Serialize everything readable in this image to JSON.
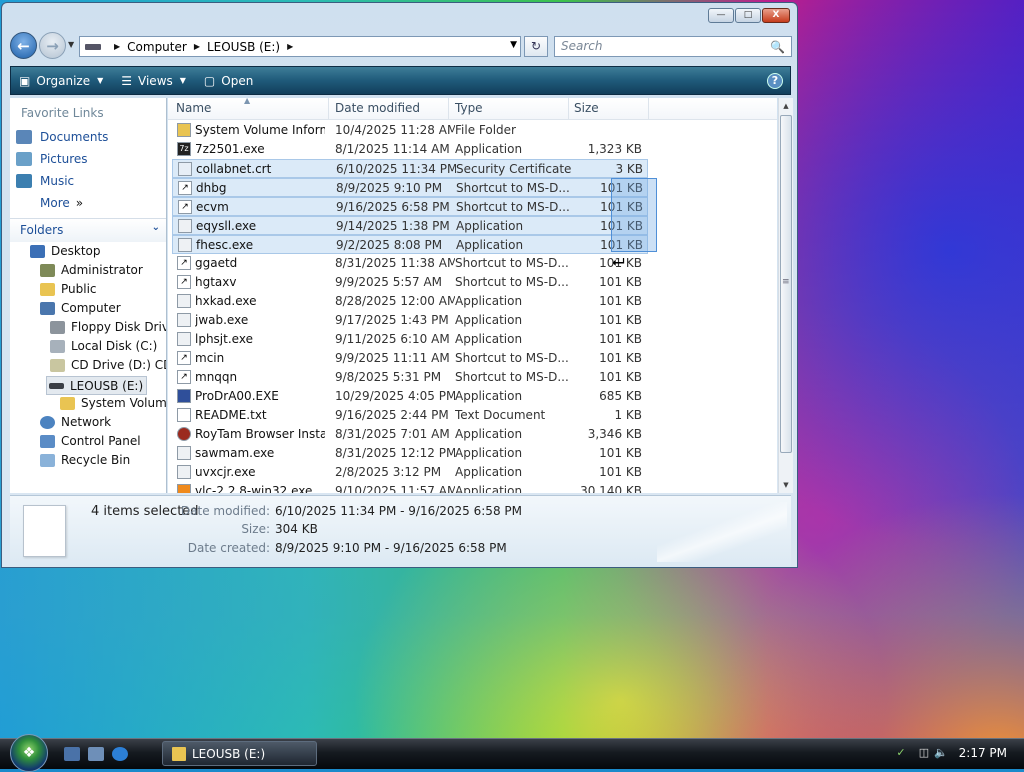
{
  "window": {
    "title_buttons": {
      "minimize": "—",
      "maximize": "□",
      "close": "X"
    },
    "address": {
      "segments": [
        "Computer",
        "LEOUSB (E:)"
      ]
    },
    "search_placeholder": "Search",
    "toolbar": {
      "organize": "Organize",
      "views": "Views",
      "open": "Open",
      "help": "?"
    }
  },
  "left_nav": {
    "favorites_header": "Favorite Links",
    "favorites": [
      {
        "label": "Documents",
        "icon": "documents-icon"
      },
      {
        "label": "Pictures",
        "icon": "pictures-icon"
      },
      {
        "label": "Music",
        "icon": "music-icon"
      },
      {
        "label": "More",
        "icon": "double-chevron-right-icon"
      }
    ],
    "folders_header": "Folders",
    "tree": [
      {
        "label": "Desktop",
        "level": 0
      },
      {
        "label": "Administrator",
        "level": 1
      },
      {
        "label": "Public",
        "level": 1
      },
      {
        "label": "Computer",
        "level": 1
      },
      {
        "label": "Floppy Disk Drive",
        "level": 2
      },
      {
        "label": "Local Disk (C:)",
        "level": 2
      },
      {
        "label": "CD Drive (D:) CDR",
        "level": 2
      },
      {
        "label": "LEOUSB (E:)",
        "level": 2,
        "selected": true
      },
      {
        "label": "System Volume",
        "level": 3
      },
      {
        "label": "Network",
        "level": 1
      },
      {
        "label": "Control Panel",
        "level": 1
      },
      {
        "label": "Recycle Bin",
        "level": 1
      }
    ]
  },
  "columns": [
    "Name",
    "Date modified",
    "Type",
    "Size"
  ],
  "files": [
    {
      "name": "System Volume Inform...",
      "date": "10/4/2025 11:28 AM",
      "type": "File Folder",
      "size": "",
      "icon": "folder-icon",
      "selected": false
    },
    {
      "name": "7z2501.exe",
      "date": "8/1/2025 11:14 AM",
      "type": "Application",
      "size": "1,323 KB",
      "icon": "7zip-icon",
      "selected": false
    },
    {
      "name": "collabnet.crt",
      "date": "6/10/2025 11:34 PM",
      "type": "Security Certificate",
      "size": "3 KB",
      "icon": "certificate-icon",
      "selected": true
    },
    {
      "name": "dhbg",
      "date": "8/9/2025 9:10 PM",
      "type": "Shortcut to MS-D...",
      "size": "101 KB",
      "icon": "shortcut-icon",
      "selected": true
    },
    {
      "name": "ecvm",
      "date": "9/16/2025 6:58 PM",
      "type": "Shortcut to MS-D...",
      "size": "101 KB",
      "icon": "shortcut-icon",
      "selected": true
    },
    {
      "name": "eqysll.exe",
      "date": "9/14/2025 1:38 PM",
      "type": "Application",
      "size": "101 KB",
      "icon": "exe-icon",
      "selected": true
    },
    {
      "name": "fhesc.exe",
      "date": "9/2/2025 8:08 PM",
      "type": "Application",
      "size": "101 KB",
      "icon": "exe-icon",
      "selected": true
    },
    {
      "name": "ggaetd",
      "date": "8/31/2025 11:38 AM",
      "type": "Shortcut to MS-D...",
      "size": "101 KB",
      "icon": "shortcut-icon",
      "selected": false
    },
    {
      "name": "hgtaxv",
      "date": "9/9/2025 5:57 AM",
      "type": "Shortcut to MS-D...",
      "size": "101 KB",
      "icon": "shortcut-icon",
      "selected": false
    },
    {
      "name": "hxkad.exe",
      "date": "8/28/2025 12:00 AM",
      "type": "Application",
      "size": "101 KB",
      "icon": "exe-icon",
      "selected": false
    },
    {
      "name": "jwab.exe",
      "date": "9/17/2025 1:43 PM",
      "type": "Application",
      "size": "101 KB",
      "icon": "exe-icon",
      "selected": false
    },
    {
      "name": "lphsjt.exe",
      "date": "9/11/2025 6:10 AM",
      "type": "Application",
      "size": "101 KB",
      "icon": "exe-icon",
      "selected": false
    },
    {
      "name": "mcin",
      "date": "9/9/2025 11:11 AM",
      "type": "Shortcut to MS-D...",
      "size": "101 KB",
      "icon": "shortcut-icon",
      "selected": false
    },
    {
      "name": "mnqqn",
      "date": "9/8/2025 5:31 PM",
      "type": "Shortcut to MS-D...",
      "size": "101 KB",
      "icon": "shortcut-icon",
      "selected": false
    },
    {
      "name": "ProDrA00.EXE",
      "date": "10/29/2025 4:05 PM",
      "type": "Application",
      "size": "685 KB",
      "icon": "setup-icon",
      "selected": false
    },
    {
      "name": "README.txt",
      "date": "9/16/2025 2:44 PM",
      "type": "Text Document",
      "size": "1 KB",
      "icon": "text-document-icon",
      "selected": false
    },
    {
      "name": "RoyTam Browser Instal...",
      "date": "8/31/2025 7:01 AM",
      "type": "Application",
      "size": "3,346 KB",
      "icon": "browser-installer-icon",
      "selected": false
    },
    {
      "name": "sawmam.exe",
      "date": "8/31/2025 12:12 PM",
      "type": "Application",
      "size": "101 KB",
      "icon": "exe-icon",
      "selected": false
    },
    {
      "name": "uvxcjr.exe",
      "date": "2/8/2025 3:12 PM",
      "type": "Application",
      "size": "101 KB",
      "icon": "exe-icon",
      "selected": false
    },
    {
      "name": "vlc-2.2.8-win32.exe",
      "date": "9/10/2025 11:57 AM",
      "type": "Application",
      "size": "30,140 KB",
      "icon": "vlc-icon",
      "selected": false
    }
  ],
  "details": {
    "count": "4 items selected",
    "date_modified_label": "Date modified:",
    "date_modified": "6/10/2025 11:34 PM - 9/16/2025 6:58 PM",
    "size_label": "Size:",
    "size": "304 KB",
    "date_created_label": "Date created:",
    "date_created": "8/9/2025 9:10 PM - 9/16/2025 6:58 PM"
  },
  "taskbar": {
    "task": "LEOUSB (E:)",
    "clock": "2:17 PM"
  },
  "colors": {
    "selection": "#dbeaf8",
    "command_bar": "#1f5a7a",
    "link_blue": "#1d4f98"
  }
}
